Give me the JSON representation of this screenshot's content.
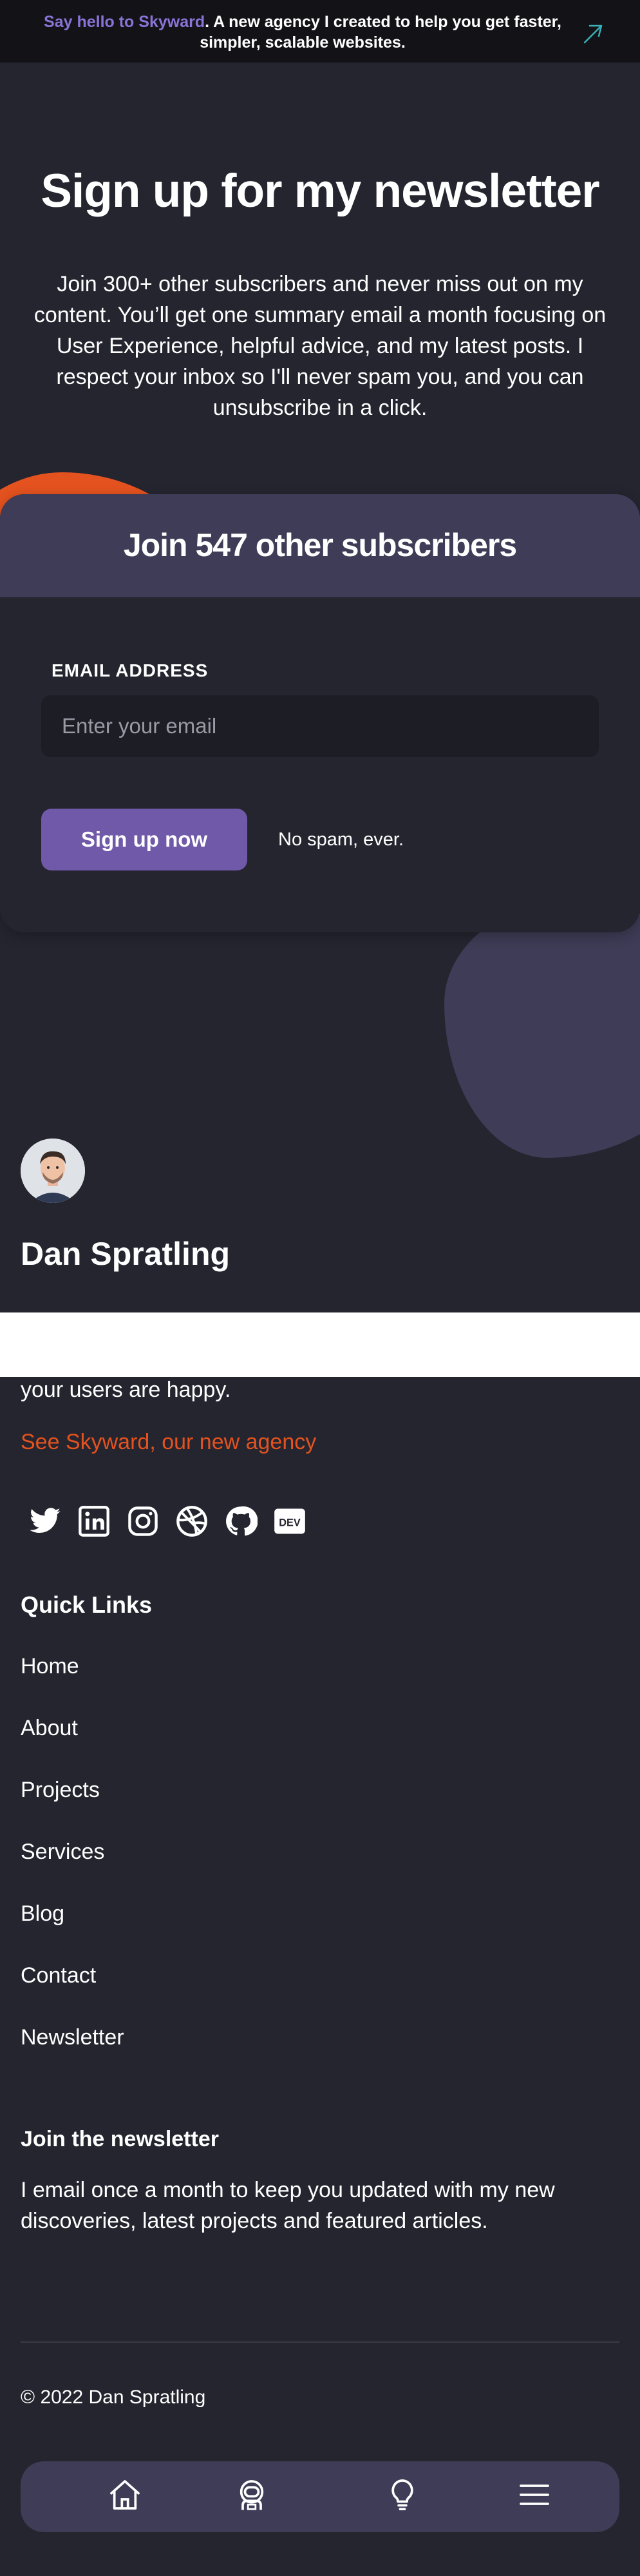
{
  "announcement": {
    "highlight": "Say hello to Skyward",
    "text": ". A new agency I created to help you get faster, simpler, scalable websites.",
    "arrow_icon": "arrow-up-right-icon"
  },
  "hero": {
    "title": "Sign up for my newsletter",
    "description": "Join 300+ other subscribers and never miss out on my content. You’ll get one summary email a month focusing on User Experience, helpful advice, and my latest posts. I respect your inbox so I'll never spam you, and you can unsubscribe in a click."
  },
  "signup_card": {
    "title": "Join 547 other subscribers",
    "email_label": "EMAIL ADDRESS",
    "email_placeholder": "Enter your email",
    "email_value": "",
    "button_label": "Sign up now",
    "note": "No spam, ever."
  },
  "author": {
    "name": "Dan Spratling"
  },
  "footer": {
    "tail_text": "your users are happy.",
    "agency_link": "See Skyward, our new agency",
    "social_icons": [
      "twitter-icon",
      "linkedin-icon",
      "instagram-icon",
      "dribbble-icon",
      "github-icon",
      "dev-icon"
    ],
    "quick_links_title": "Quick Links",
    "quick_links": [
      "Home",
      "About",
      "Projects",
      "Services",
      "Blog",
      "Contact",
      "Newsletter"
    ],
    "newsletter_title": "Join the newsletter",
    "newsletter_desc": "I email once a month to keep you updated with my new discoveries, latest projects and featured articles.",
    "copyright": "© 2022 Dan Spratling"
  },
  "bottom_nav": {
    "icons": [
      "home-icon",
      "astronaut-icon",
      "lightbulb-icon",
      "menu-icon"
    ]
  },
  "colors": {
    "background": "#24252f",
    "accent_purple": "#7059a8",
    "accent_orange": "#e4521f",
    "card_header": "#3e3c56",
    "announcement_bg": "#121217"
  }
}
